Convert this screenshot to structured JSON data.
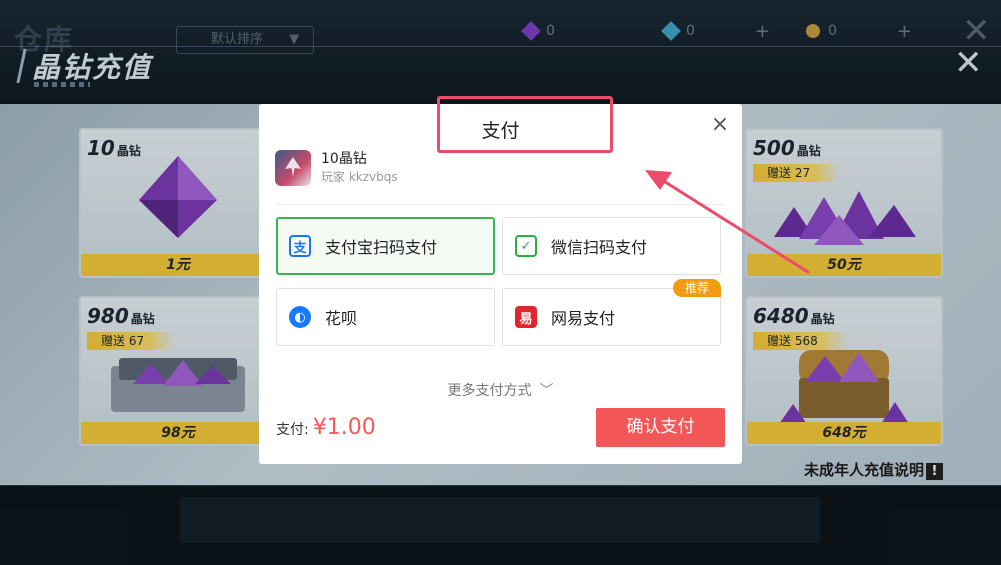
{
  "background": {
    "faded_title": "仓库",
    "sort_label": "默认排序",
    "title": "晶钻充值",
    "currencies": [
      {
        "icon": "purple-crystal-icon",
        "value": "0",
        "color": "#7d3fc4"
      },
      {
        "icon": "blue-crystal-icon",
        "value": "0",
        "color": "#3fa6c4"
      },
      {
        "icon": "gold-coin-icon",
        "value": "0",
        "color": "#c49a3f"
      }
    ],
    "plus": "+",
    "close_symbol": "✕",
    "cards": [
      {
        "amount": "10",
        "unit": "晶钻",
        "bonus": "",
        "price": "1元"
      },
      {
        "amount": "500",
        "unit": "晶钻",
        "bonus": "赠送 27",
        "price": "50元"
      },
      {
        "amount": "980",
        "unit": "晶钻",
        "bonus": "赠送 67",
        "price": "98元"
      },
      {
        "amount": "6480",
        "unit": "晶钻",
        "bonus": "赠送 568",
        "price": "648元"
      }
    ],
    "minor_note": "未成年人充值说明",
    "minor_note_icon": "!"
  },
  "dialog": {
    "title": "支付",
    "close_symbol": "×",
    "product": {
      "name": "10晶钻",
      "user": "玩家 kkzvbqs"
    },
    "methods": [
      {
        "label": "支付宝扫码支付",
        "icon": "alipay-icon",
        "glyph": "支",
        "selected": true,
        "badge": ""
      },
      {
        "label": "微信扫码支付",
        "icon": "wechat-icon",
        "glyph": "✓",
        "selected": false,
        "badge": ""
      },
      {
        "label": "花呗",
        "icon": "huabei-icon",
        "glyph": "◐",
        "selected": false,
        "badge": ""
      },
      {
        "label": "网易支付",
        "icon": "netease-pay-icon",
        "glyph": "易",
        "selected": false,
        "badge": "推荐"
      }
    ],
    "more_methods": "更多支付方式",
    "more_chevron": "﹀",
    "total_label": "支付:",
    "total_amount": "¥1.00",
    "confirm_label": "确认支付"
  },
  "colors": {
    "selected_border": "#36b64b",
    "confirm_button": "#f25656",
    "price_red": "#f25a5a",
    "annotation": "#ec4b6a",
    "badge": "#f39c12"
  }
}
